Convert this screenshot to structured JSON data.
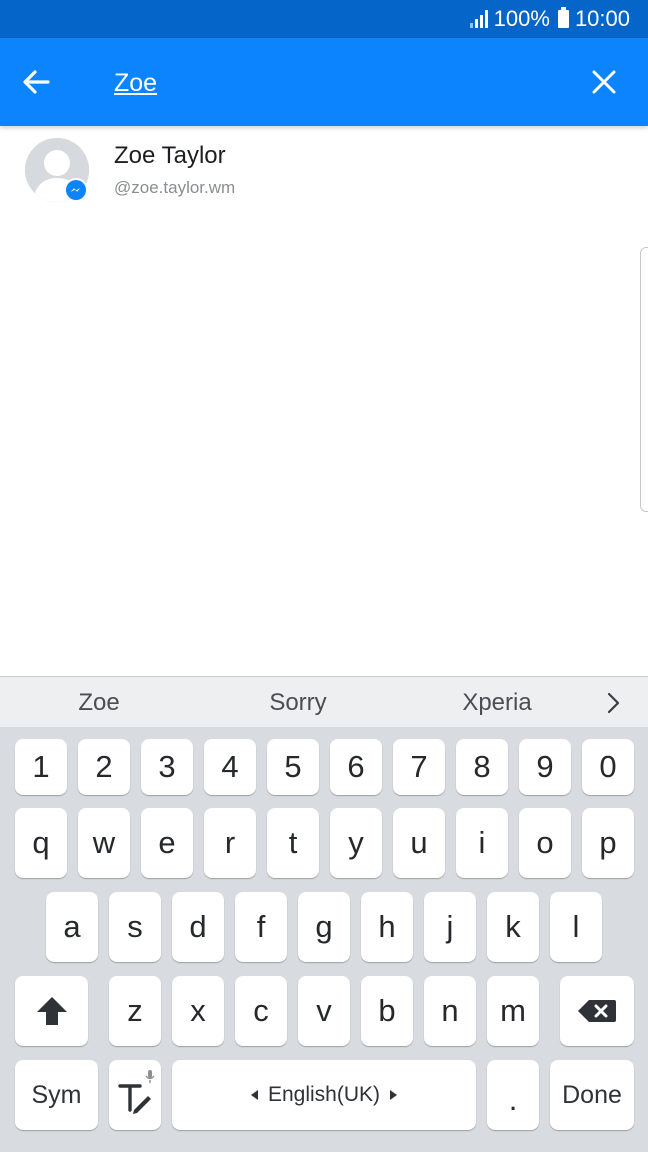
{
  "status_bar": {
    "battery": "100%",
    "time": "10:00"
  },
  "search": {
    "query": "Zoe"
  },
  "results": [
    {
      "name": "Zoe Taylor",
      "handle": "@zoe.taylor.wm",
      "badge": "messenger-icon"
    }
  ],
  "keyboard": {
    "suggestions": [
      "Zoe",
      "Sorry",
      "Xperia"
    ],
    "number_row": [
      "1",
      "2",
      "3",
      "4",
      "5",
      "6",
      "7",
      "8",
      "9",
      "0"
    ],
    "row1": [
      "q",
      "w",
      "e",
      "r",
      "t",
      "y",
      "u",
      "i",
      "o",
      "p"
    ],
    "row2": [
      "a",
      "s",
      "d",
      "f",
      "g",
      "h",
      "j",
      "k",
      "l"
    ],
    "row3": [
      "z",
      "x",
      "c",
      "v",
      "b",
      "n",
      "m"
    ],
    "sym_label": "Sym",
    "space_label": "English(UK)",
    "period_label": ".",
    "done_label": "Done"
  },
  "colors": {
    "status_bar": "#0565c8",
    "toolbar": "#0b84fd",
    "keyboard_bg": "#d8dce1",
    "suggestion_bg": "#eeeff1",
    "messenger_badge": "#0b84fd"
  }
}
